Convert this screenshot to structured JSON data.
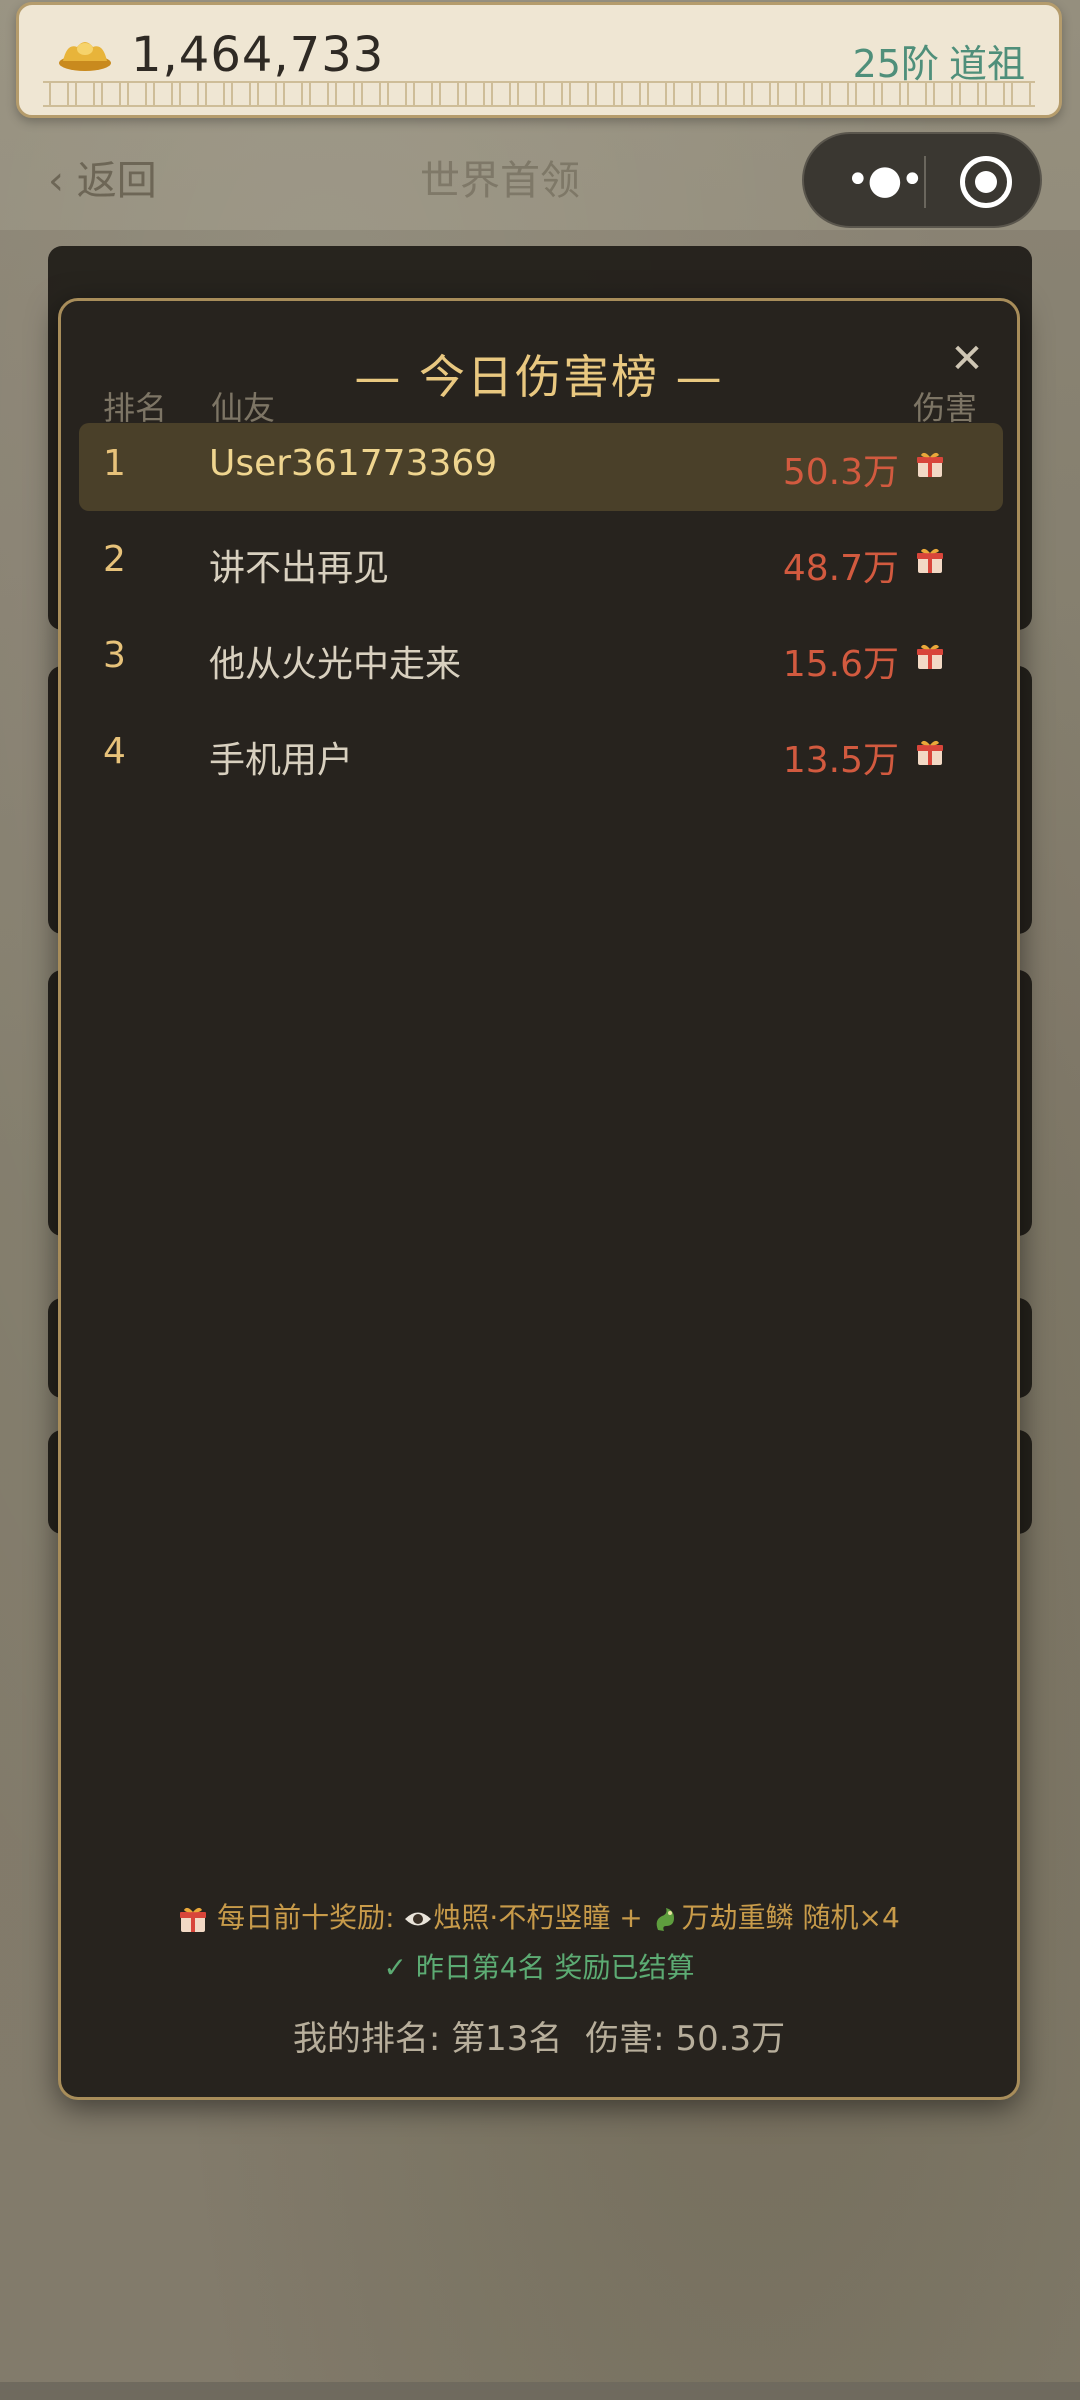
{
  "topbar": {
    "coins": "1,464,733",
    "rank_level": "25阶",
    "rank_title": "道祖",
    "icon": "gold-ingot-icon"
  },
  "nav": {
    "back_label": "返回",
    "page_title": "世界首领"
  },
  "modal": {
    "title": "— 今日伤害榜 —",
    "headers": {
      "rank": "排名",
      "player": "仙友",
      "damage": "伤害"
    },
    "rows": [
      {
        "rank": "1",
        "name": "User361773369",
        "damage": "50.3万"
      },
      {
        "rank": "2",
        "name": "讲不出再见",
        "damage": "48.7万"
      },
      {
        "rank": "3",
        "name": "他从火光中走来",
        "damage": "15.6万"
      },
      {
        "rank": "4",
        "name": "手机用户",
        "damage": "13.5万"
      }
    ],
    "reward_prefix": "每日前十奖励:",
    "reward_item1": "烛照·不朽竖瞳",
    "reward_plus": "+",
    "reward_item2": "万劫重鳞",
    "reward_suffix": "随机×4",
    "yesterday": "昨日第4名 奖励已结算",
    "my_rank_label": "我的排名: 第13名",
    "my_damage_label": "伤害: 50.3万"
  },
  "colors": {
    "accent_gold": "#e9c880",
    "damage_red": "#d25a3f",
    "success_green": "#5cab73",
    "rank_teal": "#4f8f7a"
  }
}
